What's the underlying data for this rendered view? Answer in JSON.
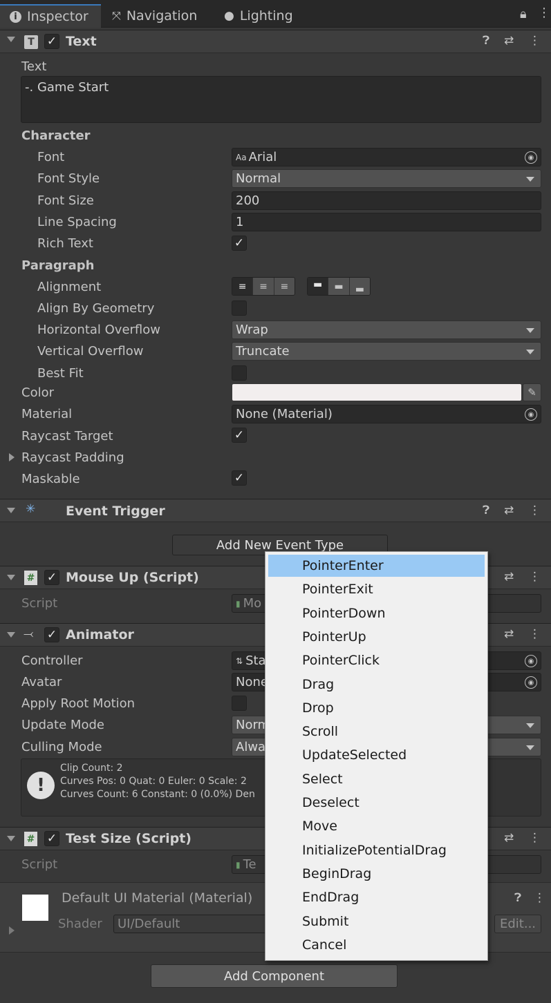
{
  "tabs": [
    {
      "label": "Inspector",
      "icon": "info-icon"
    },
    {
      "label": "Navigation",
      "icon": "navigation-icon"
    },
    {
      "label": "Lighting",
      "icon": "bulb-icon"
    }
  ],
  "text_component": {
    "title": "Text",
    "text_label": "Text",
    "text_value": "-. Game Start",
    "character_header": "Character",
    "font_label": "Font",
    "font_value": "Arial",
    "font_prefix": "Aa",
    "font_style_label": "Font Style",
    "font_style_value": "Normal",
    "font_size_label": "Font Size",
    "font_size_value": "200",
    "line_spacing_label": "Line Spacing",
    "line_spacing_value": "1",
    "rich_text_label": "Rich Text",
    "rich_text_checked": true,
    "paragraph_header": "Paragraph",
    "alignment_label": "Alignment",
    "align_by_geometry_label": "Align By Geometry",
    "align_by_geometry_checked": false,
    "horizontal_overflow_label": "Horizontal Overflow",
    "horizontal_overflow_value": "Wrap",
    "vertical_overflow_label": "Vertical Overflow",
    "vertical_overflow_value": "Truncate",
    "best_fit_label": "Best Fit",
    "best_fit_checked": false,
    "color_label": "Color",
    "color_value": "#f2eeee",
    "material_label": "Material",
    "material_value": "None (Material)",
    "raycast_target_label": "Raycast Target",
    "raycast_target_checked": true,
    "raycast_padding_label": "Raycast Padding",
    "maskable_label": "Maskable",
    "maskable_checked": true
  },
  "event_trigger": {
    "title": "Event Trigger",
    "add_button": "Add New Event Type"
  },
  "mouse_up": {
    "title": "Mouse Up (Script)",
    "script_label": "Script",
    "script_value": "Mo"
  },
  "animator": {
    "title": "Animator",
    "controller_label": "Controller",
    "controller_value": "Sta",
    "avatar_label": "Avatar",
    "avatar_value": "None",
    "apply_root_motion_label": "Apply Root Motion",
    "update_mode_label": "Update Mode",
    "update_mode_value": "Norm",
    "culling_mode_label": "Culling Mode",
    "culling_mode_value": "Alwa",
    "info_lines": [
      "Clip Count: 2",
      "Curves Pos: 0 Quat: 0 Euler: 0 Scale: 2",
      "Curves Count: 6 Constant: 0 (0.0%) Den"
    ]
  },
  "test_size": {
    "title": "Test Size (Script)",
    "script_label": "Script",
    "script_value": "Te"
  },
  "material": {
    "title": "Default UI Material (Material)",
    "shader_label": "Shader",
    "shader_value": "UI/Default",
    "edit_button": "Edit..."
  },
  "add_component": "Add Component",
  "event_menu": {
    "items": [
      "PointerEnter",
      "PointerExit",
      "PointerDown",
      "PointerUp",
      "PointerClick",
      "Drag",
      "Drop",
      "Scroll",
      "UpdateSelected",
      "Select",
      "Deselect",
      "Move",
      "InitializePotentialDrag",
      "BeginDrag",
      "EndDrag",
      "Submit",
      "Cancel"
    ],
    "selected_index": 0
  }
}
